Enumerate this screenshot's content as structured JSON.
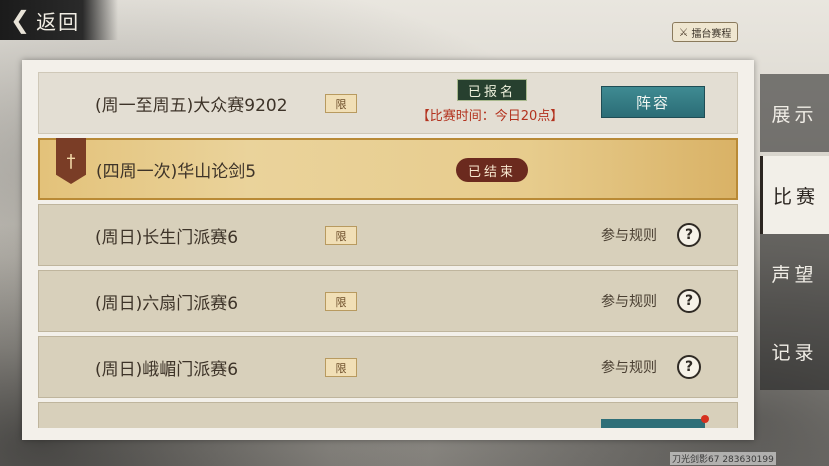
{
  "header": {
    "back_label": "返回",
    "arena_schedule_label": "擂台赛程"
  },
  "tournaments": [
    {
      "title": "(周一至周五)大众赛9202",
      "limit_tag": "限",
      "status": "已报名",
      "match_time": "【比赛时间：今日20点】",
      "action": "阵容"
    },
    {
      "title": "(四周一次)华山论剑5",
      "status": "已结束"
    },
    {
      "title": "(周日)长生门派赛6",
      "limit_tag": "限",
      "rules_label": "参与规则"
    },
    {
      "title": "(周日)六扇门派赛6",
      "limit_tag": "限",
      "rules_label": "参与规则"
    },
    {
      "title": "(周日)峨嵋门派赛6",
      "limit_tag": "限",
      "rules_label": "参与规则"
    }
  ],
  "side_nav": {
    "items": [
      {
        "label": "展示",
        "active": false
      },
      {
        "label": "比赛",
        "active": true
      },
      {
        "label": "声望",
        "active": false
      },
      {
        "label": "记录",
        "active": false
      }
    ]
  },
  "watermark": "刀光剑影67 283630199",
  "colors": {
    "accent_teal": "#2b6d76",
    "status_red": "#b3321e",
    "active_gold": "#e3c27a"
  }
}
